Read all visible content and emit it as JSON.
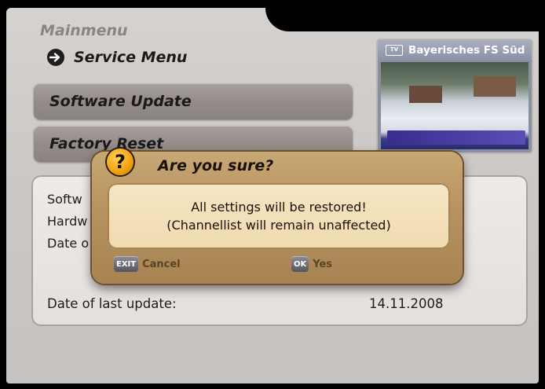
{
  "header": {
    "main_title": "Mainmenu",
    "submenu_label": "Service Menu"
  },
  "menu": {
    "items": [
      {
        "label": "Software Update"
      },
      {
        "label": "Factory Reset"
      }
    ]
  },
  "preview": {
    "channel_name": "Bayerisches FS Süd",
    "tv_badge": "TV"
  },
  "info": {
    "rows": [
      {
        "label": "Softw"
      },
      {
        "label": "Hardw"
      },
      {
        "label": "Date o"
      }
    ],
    "last_update_label": "Date of last update:",
    "last_update_value": "14.11.2008"
  },
  "dialog": {
    "title": "Are you sure?",
    "message_line1": "All settings will be restored!",
    "message_line2": "(Channellist will remain unaffected)",
    "exit_key": "EXIT",
    "cancel_label": "Cancel",
    "ok_key": "OK",
    "yes_label": "Yes"
  }
}
